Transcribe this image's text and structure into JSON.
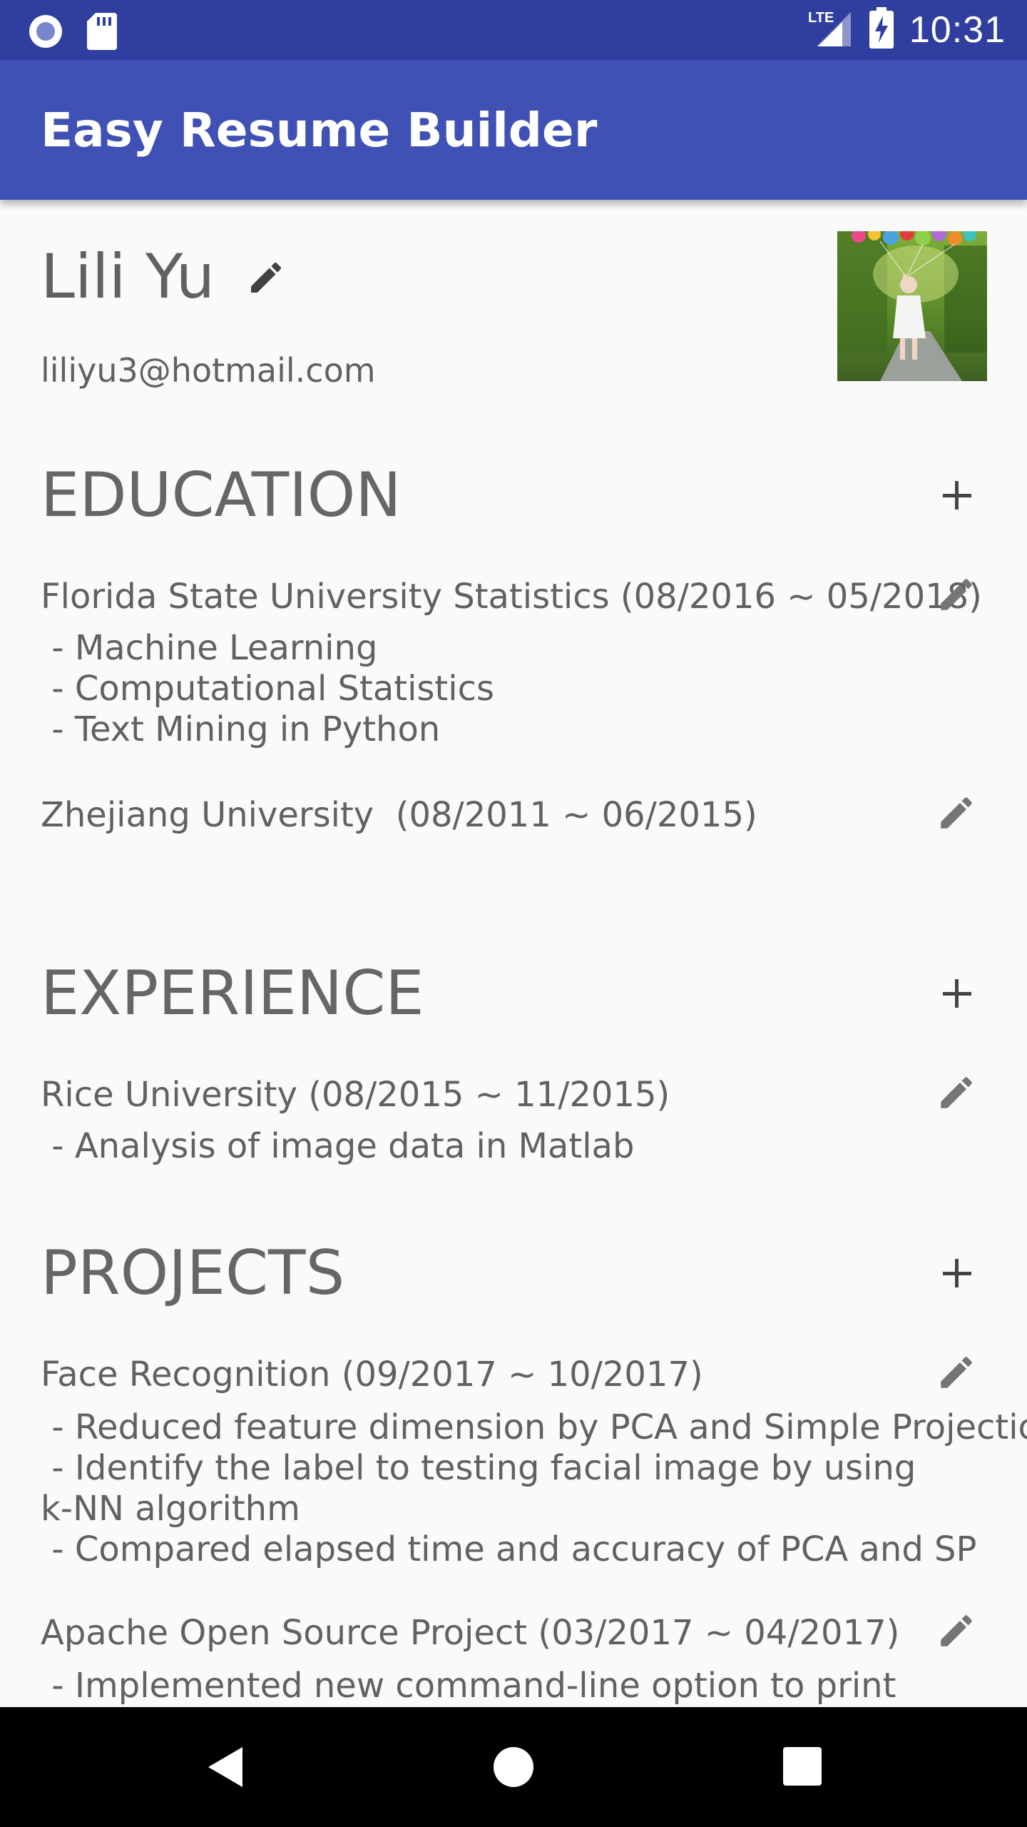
{
  "status_bar": {
    "time": "10:31",
    "network": "LTE",
    "icons": [
      "circle-notification-icon",
      "sd-card-icon",
      "lte-signal-icon",
      "battery-charging-icon"
    ]
  },
  "app_bar": {
    "title": "Easy Resume Builder",
    "color": "#3f51b5"
  },
  "profile": {
    "name": "Lili Yu",
    "email": "liliyu3@hotmail.com"
  },
  "sections": {
    "education": {
      "title": "EDUCATION",
      "entries": [
        {
          "title": "Florida State University Statistics (08/2016 ~ 05/2018)",
          "description": " - Machine Learning\n - Computational Statistics\n - Text Mining in Python"
        },
        {
          "title": "Zhejiang University  (08/2011 ~ 06/2015)",
          "description": ""
        }
      ]
    },
    "experience": {
      "title": "EXPERIENCE",
      "entries": [
        {
          "title": "Rice University (08/2015 ~ 11/2015)",
          "description": " - Analysis of image data in Matlab"
        }
      ]
    },
    "projects": {
      "title": "PROJECTS",
      "entries": [
        {
          "title": "Face Recognition (09/2017 ~ 10/2017)",
          "description": " - Reduced feature dimension by PCA and Simple Projection\n - Identify the label to testing facial image by using\nk-NN algorithm\n - Compared elapsed time and accuracy of PCA and SP"
        },
        {
          "title": "Apache Open Source Project (03/2017 ~ 04/2017)",
          "description": " - Implemented new command-line option to print"
        }
      ]
    }
  },
  "nav_bar": {
    "icons": [
      "back-icon",
      "home-icon",
      "recents-icon"
    ]
  }
}
